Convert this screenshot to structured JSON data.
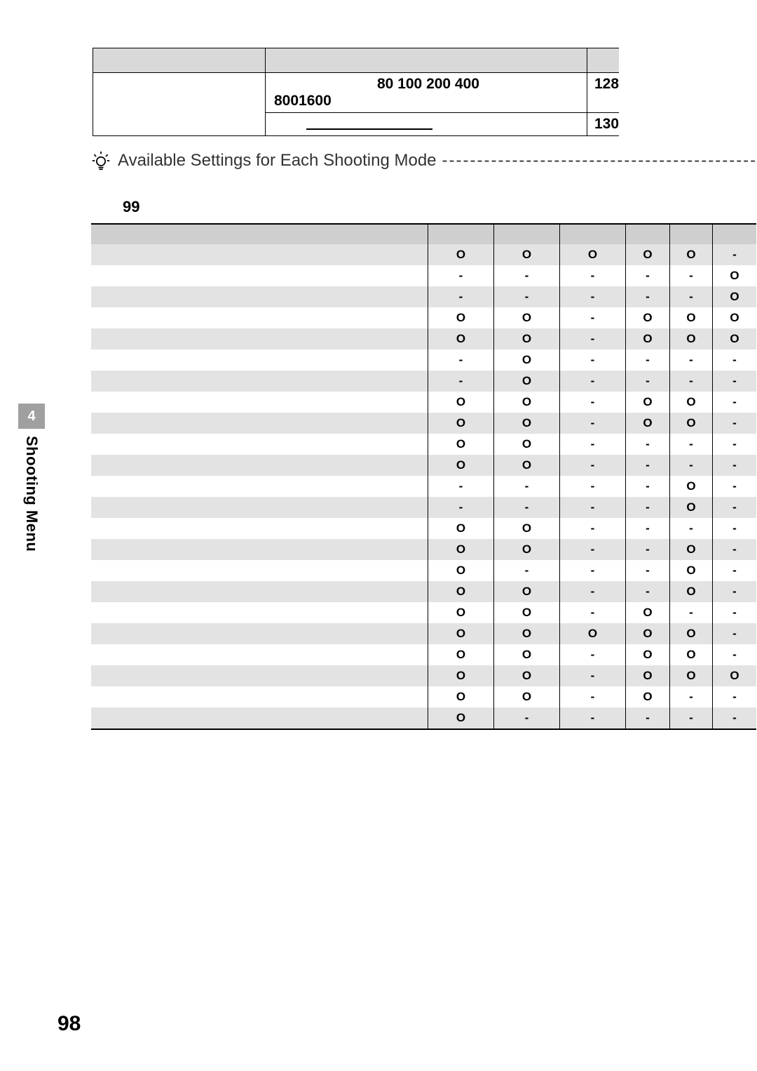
{
  "top_table": {
    "row1_col2": "80 100 200 400",
    "row1_col3": "128",
    "row2_left_inset": "8001600",
    "row3_col3": "130"
  },
  "tip_heading": "Available Settings for Each Shooting Mode",
  "legend_label": "99",
  "availability": [
    [
      "O",
      "O",
      "O",
      "O",
      "O",
      "-"
    ],
    [
      "-",
      "-",
      "-",
      "-",
      "-",
      "O"
    ],
    [
      "-",
      "-",
      "-",
      "-",
      "-",
      "O"
    ],
    [
      "O",
      "O",
      "-",
      "O",
      "O",
      "O"
    ],
    [
      "O",
      "O",
      "-",
      "O",
      "O",
      "O"
    ],
    [
      "-",
      "O",
      "-",
      "-",
      "-",
      "-"
    ],
    [
      "-",
      "O",
      "-",
      "-",
      "-",
      "-"
    ],
    [
      "O",
      "O",
      "-",
      "O",
      "O",
      "-"
    ],
    [
      "O",
      "O",
      "-",
      "O",
      "O",
      "-"
    ],
    [
      "O",
      "O",
      "-",
      "-",
      "-",
      "-"
    ],
    [
      "O",
      "O",
      "-",
      "-",
      "-",
      "-"
    ],
    [
      "-",
      "-",
      "-",
      "-",
      "O",
      "-"
    ],
    [
      "-",
      "-",
      "-",
      "-",
      "O",
      "-"
    ],
    [
      "O",
      "O",
      "-",
      "-",
      "-",
      "-"
    ],
    [
      "O",
      "O",
      "-",
      "-",
      "O",
      "-"
    ],
    [
      "O",
      "-",
      "-",
      "-",
      "O",
      "-"
    ],
    [
      "O",
      "O",
      "-",
      "-",
      "O",
      "-"
    ],
    [
      "O",
      "O",
      "-",
      "O",
      "-",
      "-"
    ],
    [
      "O",
      "O",
      "O",
      "O",
      "O",
      "-"
    ],
    [
      "O",
      "O",
      "-",
      "O",
      "O",
      "-"
    ],
    [
      "O",
      "O",
      "-",
      "O",
      "O",
      "O"
    ],
    [
      "O",
      "O",
      "-",
      "O",
      "-",
      "-"
    ],
    [
      "O",
      "-",
      "-",
      "-",
      "-",
      "-"
    ]
  ],
  "side_tab_number": "4",
  "side_tab_label": "Shooting Menu",
  "page_number": "98"
}
